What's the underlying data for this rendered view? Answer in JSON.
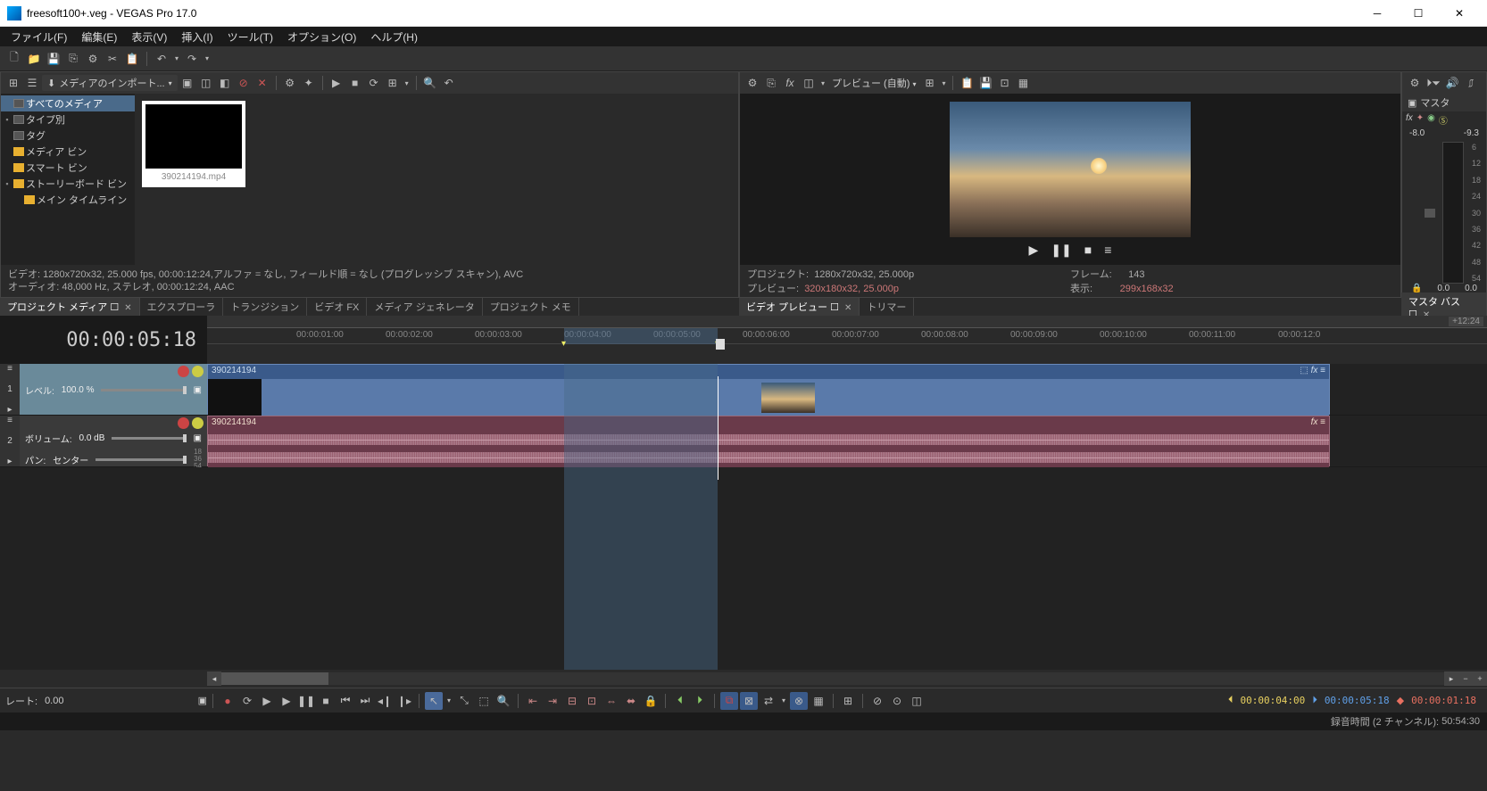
{
  "window": {
    "title": "freesoft100+.veg - VEGAS Pro 17.0"
  },
  "menu": {
    "file": "ファイル(F)",
    "edit": "編集(E)",
    "view": "表示(V)",
    "insert": "挿入(I)",
    "tools": "ツール(T)",
    "options": "オプション(O)",
    "help": "ヘルプ(H)"
  },
  "media": {
    "import_label": "メディアのインポート...",
    "tree": {
      "all": "すべてのメディア",
      "bytype": "タイプ別",
      "tags": "タグ",
      "mediabin": "メディア ビン",
      "smartbin": "スマート ビン",
      "storyboard": "ストーリーボード ビン",
      "maintimeline": "メイン タイムライン"
    },
    "thumb_name": "390214194.mp4",
    "info_video": "ビデオ: 1280x720x32, 25.000 fps, 00:00:12:24,アルファ = なし, フィールド順 = なし (プログレッシブ スキャン), AVC",
    "info_audio": "オーディオ: 48,000 Hz, ステレオ, 00:00:12:24, AAC"
  },
  "tabs_left": [
    "プロジェクト メディア",
    "エクスプローラ",
    "トランジション",
    "ビデオ FX",
    "メディア ジェネレータ",
    "プロジェクト メモ"
  ],
  "preview": {
    "mode_label": "プレビュー (自動)",
    "project_label": "プロジェクト:",
    "project_val": "1280x720x32, 25.000p",
    "preview_label": "プレビュー:",
    "preview_val": "320x180x32, 25.000p",
    "frame_label": "フレーム:",
    "frame_val": "143",
    "display_label": "表示:",
    "display_val": "299x168x32"
  },
  "tabs_right": [
    "ビデオ プレビュー",
    "トリマー"
  ],
  "master": {
    "label": "マスタ",
    "db_left": "-8.0",
    "db_right": "-9.3",
    "scale": [
      "6",
      "12",
      "18",
      "24",
      "30",
      "36",
      "42",
      "48",
      "54"
    ],
    "bottom_left": "0.0",
    "bottom_right": "0.0",
    "tab": "マスタ バス"
  },
  "timeline": {
    "timecode": "00:00:05:18",
    "duration_tag": "+12:24",
    "ruler": [
      "00:00:01:00",
      "00:00:02:00",
      "00:00:03:00",
      "00:00:04:00",
      "00:00:05:00",
      "00:00:06:00",
      "00:00:07:00",
      "00:00:08:00",
      "00:00:09:00",
      "00:00:10:00",
      "00:00:11:00",
      "00:00:12:0"
    ],
    "track1": {
      "num": "1",
      "level_label": "レベル:",
      "level_val": "100.0 %"
    },
    "track2": {
      "num": "2",
      "vol_label": "ボリューム:",
      "vol_val": "0.0 dB",
      "pan_label": "パン:",
      "pan_val": "センター",
      "scale": [
        "18",
        "36",
        "54"
      ]
    },
    "clip_name": "390214194"
  },
  "rate": {
    "label": "レート:",
    "value": "0.00"
  },
  "transport_tc": {
    "in": "00:00:04:00",
    "out": "00:00:05:18",
    "len": "00:00:01:18"
  },
  "status": {
    "rec_label": "録音時間 (2 チャンネル):",
    "rec_val": "50:54:30"
  }
}
